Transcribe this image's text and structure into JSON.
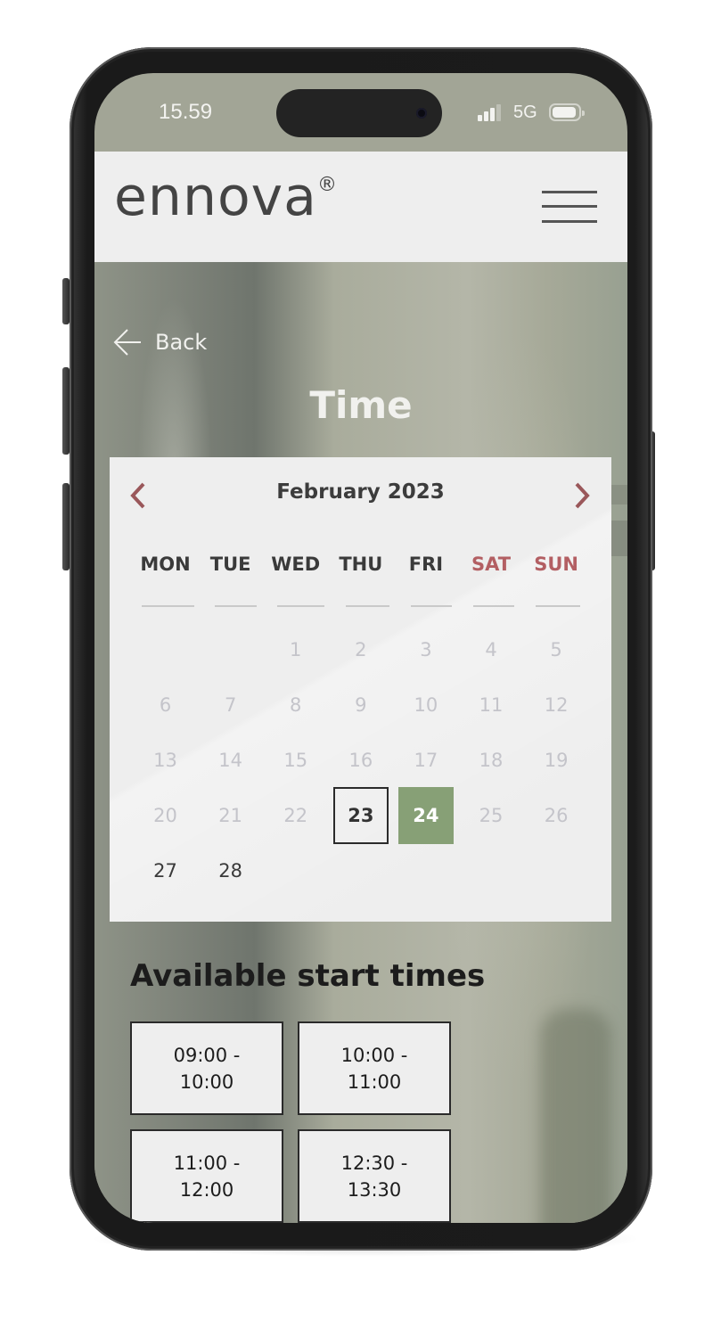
{
  "status_bar": {
    "time": "15.59",
    "network": "5G",
    "icons": [
      "signal-icon",
      "battery-icon"
    ]
  },
  "header": {
    "logo_text": "ennova",
    "logo_mark": "®",
    "menu_icon": "hamburger-icon"
  },
  "nav": {
    "back_label": "Back",
    "back_icon": "arrow-left-icon"
  },
  "page": {
    "title": "Time"
  },
  "calendar": {
    "month_label": "February 2023",
    "prev_icon": "chevron-left-icon",
    "next_icon": "chevron-right-icon",
    "weekend_color": "#b35f63",
    "selected_color": "#87a076",
    "weekdays": [
      {
        "label": "MON",
        "weekend": false
      },
      {
        "label": "TUE",
        "weekend": false
      },
      {
        "label": "WED",
        "weekend": false
      },
      {
        "label": "THU",
        "weekend": false
      },
      {
        "label": "FRI",
        "weekend": false
      },
      {
        "label": "SAT",
        "weekend": true
      },
      {
        "label": "SUN",
        "weekend": true
      }
    ],
    "weeks": [
      [
        {
          "d": ""
        },
        {
          "d": ""
        },
        {
          "d": "1",
          "s": "disabled"
        },
        {
          "d": "2",
          "s": "disabled"
        },
        {
          "d": "3",
          "s": "disabled"
        },
        {
          "d": "4",
          "s": "disabled"
        },
        {
          "d": "5",
          "s": "disabled"
        }
      ],
      [
        {
          "d": "6",
          "s": "disabled"
        },
        {
          "d": "7",
          "s": "disabled"
        },
        {
          "d": "8",
          "s": "disabled"
        },
        {
          "d": "9",
          "s": "disabled"
        },
        {
          "d": "10",
          "s": "disabled"
        },
        {
          "d": "11",
          "s": "disabled"
        },
        {
          "d": "12",
          "s": "disabled"
        }
      ],
      [
        {
          "d": "13",
          "s": "disabled"
        },
        {
          "d": "14",
          "s": "disabled"
        },
        {
          "d": "15",
          "s": "disabled"
        },
        {
          "d": "16",
          "s": "disabled"
        },
        {
          "d": "17",
          "s": "disabled"
        },
        {
          "d": "18",
          "s": "disabled"
        },
        {
          "d": "19",
          "s": "disabled"
        }
      ],
      [
        {
          "d": "20",
          "s": "disabled"
        },
        {
          "d": "21",
          "s": "disabled"
        },
        {
          "d": "22",
          "s": "disabled"
        },
        {
          "d": "23",
          "s": "today"
        },
        {
          "d": "24",
          "s": "selected"
        },
        {
          "d": "25",
          "s": "disabled"
        },
        {
          "d": "26",
          "s": "disabled"
        }
      ],
      [
        {
          "d": "27",
          "s": "available"
        },
        {
          "d": "28",
          "s": "available"
        },
        {
          "d": ""
        },
        {
          "d": ""
        },
        {
          "d": ""
        },
        {
          "d": ""
        },
        {
          "d": ""
        }
      ]
    ]
  },
  "times": {
    "title": "Available start times",
    "slots": [
      {
        "start": "09:00",
        "end": "10:00",
        "label": "09:00 - 10:00"
      },
      {
        "start": "10:00",
        "end": "11:00",
        "label": "10:00 - 11:00"
      },
      {
        "start": "11:00",
        "end": "12:00",
        "label": "11:00 - 12:00"
      },
      {
        "start": "12:30",
        "end": "13:30",
        "label": "12:30 - 13:30"
      }
    ]
  }
}
